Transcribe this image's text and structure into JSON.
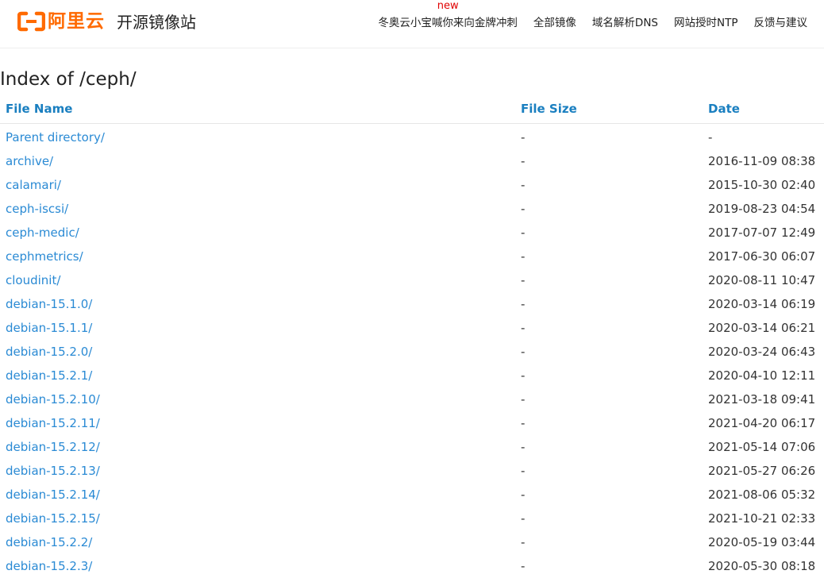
{
  "header": {
    "logo_text": "阿里云",
    "site_title": "开源镜像站",
    "nav": [
      {
        "label": "冬奥云小宝喊你来向金牌冲刺",
        "badge": "new"
      },
      {
        "label": "全部镜像"
      },
      {
        "label": "域名解析DNS"
      },
      {
        "label": "网站授时NTP"
      },
      {
        "label": "反馈与建议"
      }
    ],
    "brand_color": "#ff6a00"
  },
  "page_title": "Index of /ceph/",
  "table": {
    "columns": [
      "File Name",
      "File Size",
      "Date"
    ],
    "rows": [
      {
        "name": "Parent directory/",
        "size": "-",
        "date": "-"
      },
      {
        "name": "archive/",
        "size": "-",
        "date": "2016-11-09 08:38"
      },
      {
        "name": "calamari/",
        "size": "-",
        "date": "2015-10-30 02:40"
      },
      {
        "name": "ceph-iscsi/",
        "size": "-",
        "date": "2019-08-23 04:54"
      },
      {
        "name": "ceph-medic/",
        "size": "-",
        "date": "2017-07-07 12:49"
      },
      {
        "name": "cephmetrics/",
        "size": "-",
        "date": "2017-06-30 06:07"
      },
      {
        "name": "cloudinit/",
        "size": "-",
        "date": "2020-08-11 10:47"
      },
      {
        "name": "debian-15.1.0/",
        "size": "-",
        "date": "2020-03-14 06:19"
      },
      {
        "name": "debian-15.1.1/",
        "size": "-",
        "date": "2020-03-14 06:21"
      },
      {
        "name": "debian-15.2.0/",
        "size": "-",
        "date": "2020-03-24 06:43"
      },
      {
        "name": "debian-15.2.1/",
        "size": "-",
        "date": "2020-04-10 12:11"
      },
      {
        "name": "debian-15.2.10/",
        "size": "-",
        "date": "2021-03-18 09:41"
      },
      {
        "name": "debian-15.2.11/",
        "size": "-",
        "date": "2021-04-20 06:17"
      },
      {
        "name": "debian-15.2.12/",
        "size": "-",
        "date": "2021-05-14 07:06"
      },
      {
        "name": "debian-15.2.13/",
        "size": "-",
        "date": "2021-05-27 06:26"
      },
      {
        "name": "debian-15.2.14/",
        "size": "-",
        "date": "2021-08-06 05:32"
      },
      {
        "name": "debian-15.2.15/",
        "size": "-",
        "date": "2021-10-21 02:33"
      },
      {
        "name": "debian-15.2.2/",
        "size": "-",
        "date": "2020-05-19 03:44"
      },
      {
        "name": "debian-15.2.3/",
        "size": "-",
        "date": "2020-05-30 08:18"
      }
    ]
  }
}
